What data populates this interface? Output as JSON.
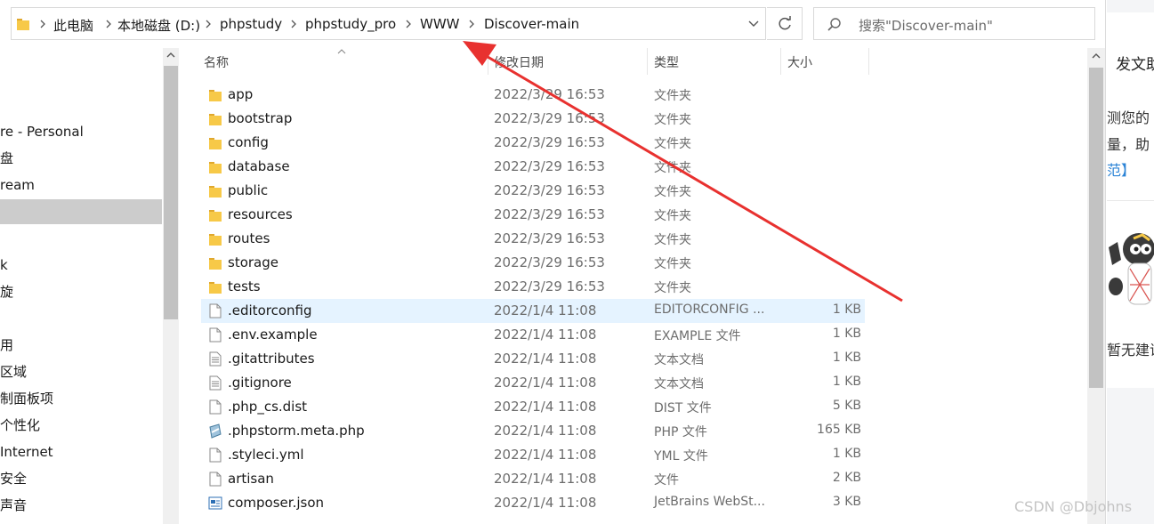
{
  "address_bar": {
    "crumbs": [
      "此电脑",
      "本地磁盘 (D:)",
      "phpstudy",
      "phpstudy_pro",
      "WWW",
      "Discover-main"
    ]
  },
  "search": {
    "placeholder": "搜索\"Discover-main\""
  },
  "nav_pane": {
    "items": [
      {
        "label": "re - Personal"
      },
      {
        "label": "盘"
      },
      {
        "label": "ream"
      },
      {
        "label": ""
      },
      {
        "label": "k"
      },
      {
        "label": "旋"
      },
      {
        "label": "用"
      },
      {
        "label": "区域"
      },
      {
        "label": "制面板项"
      },
      {
        "label": "个性化"
      },
      {
        "label": " Internet"
      },
      {
        "label": "安全"
      },
      {
        "label": "声音"
      }
    ]
  },
  "columns": {
    "name": "名称",
    "date": "修改日期",
    "type": "类型",
    "size": "大小"
  },
  "files": [
    {
      "name": "app",
      "date": "2022/3/29 16:53",
      "type": "文件夹",
      "size": "",
      "icon": "folder-icon"
    },
    {
      "name": "bootstrap",
      "date": "2022/3/29 16:53",
      "type": "文件夹",
      "size": "",
      "icon": "folder-icon"
    },
    {
      "name": "config",
      "date": "2022/3/29 16:53",
      "type": "文件夹",
      "size": "",
      "icon": "folder-icon"
    },
    {
      "name": "database",
      "date": "2022/3/29 16:53",
      "type": "文件夹",
      "size": "",
      "icon": "folder-icon"
    },
    {
      "name": "public",
      "date": "2022/3/29 16:53",
      "type": "文件夹",
      "size": "",
      "icon": "folder-icon"
    },
    {
      "name": "resources",
      "date": "2022/3/29 16:53",
      "type": "文件夹",
      "size": "",
      "icon": "folder-icon"
    },
    {
      "name": "routes",
      "date": "2022/3/29 16:53",
      "type": "文件夹",
      "size": "",
      "icon": "folder-icon"
    },
    {
      "name": "storage",
      "date": "2022/3/29 16:53",
      "type": "文件夹",
      "size": "",
      "icon": "folder-icon"
    },
    {
      "name": "tests",
      "date": "2022/3/29 16:53",
      "type": "文件夹",
      "size": "",
      "icon": "folder-icon"
    },
    {
      "name": ".editorconfig",
      "date": "2022/1/4 11:08",
      "type": "EDITORCONFIG ...",
      "size": "1 KB",
      "icon": "file-icon"
    },
    {
      "name": ".env.example",
      "date": "2022/1/4 11:08",
      "type": "EXAMPLE 文件",
      "size": "1 KB",
      "icon": "file-icon"
    },
    {
      "name": ".gitattributes",
      "date": "2022/1/4 11:08",
      "type": "文本文档",
      "size": "1 KB",
      "icon": "text-file-icon"
    },
    {
      "name": ".gitignore",
      "date": "2022/1/4 11:08",
      "type": "文本文档",
      "size": "1 KB",
      "icon": "text-file-icon"
    },
    {
      "name": ".php_cs.dist",
      "date": "2022/1/4 11:08",
      "type": "DIST 文件",
      "size": "5 KB",
      "icon": "file-icon"
    },
    {
      "name": ".phpstorm.meta.php",
      "date": "2022/1/4 11:08",
      "type": "PHP 文件",
      "size": "165 KB",
      "icon": "php-file-icon"
    },
    {
      "name": ".styleci.yml",
      "date": "2022/1/4 11:08",
      "type": "YML 文件",
      "size": "1 KB",
      "icon": "file-icon"
    },
    {
      "name": "artisan",
      "date": "2022/1/4 11:08",
      "type": "文件",
      "size": "2 KB",
      "icon": "file-icon"
    },
    {
      "name": "composer.json",
      "date": "2022/1/4 11:08",
      "type": "JetBrains WebSt...",
      "size": "3 KB",
      "icon": "json-file-icon"
    }
  ],
  "web_panel": {
    "line1": "发文助",
    "line2": "测您的",
    "line3": "量，助",
    "link": "范】",
    "line4": "暂无建议"
  },
  "watermark": "CSDN @Dbjohns",
  "colors": {
    "selection": "#e5f3ff",
    "nav_selected": "#cccccc",
    "annotation_arrow": "#e8312f",
    "folder": "#f7c948",
    "link": "#2b83d6"
  }
}
